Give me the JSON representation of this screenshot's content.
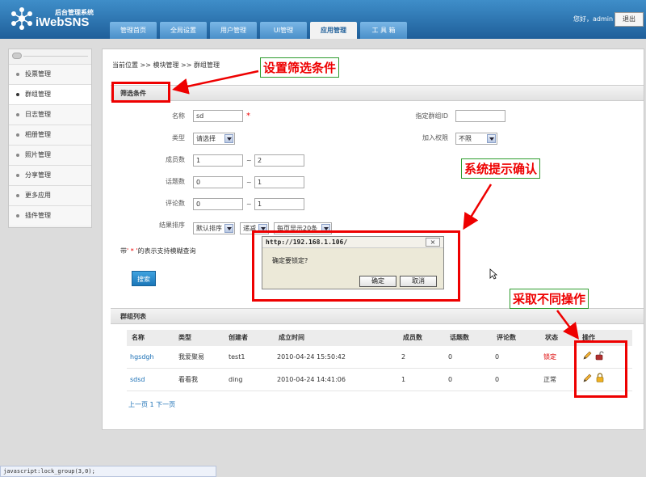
{
  "header": {
    "subtitle": "后台管理系统",
    "brand": "iWebSNS",
    "greeting": "您好，admin",
    "logout_label": "退出",
    "tabs": [
      {
        "label": "管理首页"
      },
      {
        "label": "全局设置"
      },
      {
        "label": "用户管理"
      },
      {
        "label": "UI管理"
      },
      {
        "label": "应用管理",
        "active": true
      },
      {
        "label": "工 具 箱"
      }
    ]
  },
  "sidebar": {
    "items": [
      {
        "label": "投票管理"
      },
      {
        "label": "群组管理",
        "active": true
      },
      {
        "label": "日志管理"
      },
      {
        "label": "相册管理"
      },
      {
        "label": "照片管理"
      },
      {
        "label": "分享管理"
      },
      {
        "label": "更多应用"
      },
      {
        "label": "插件管理"
      }
    ]
  },
  "breadcrumb": "当前位置 >> 模块管理 >> 群组管理",
  "filter": {
    "heading": "筛选条件",
    "name_label": "名称",
    "name_value": "sd",
    "required_mark": "*",
    "group_id_label": "指定群组ID",
    "group_id_value": "",
    "type_label": "类型",
    "type_value": "请选择",
    "join_label": "加入权限",
    "join_value": "不限",
    "members_label": "成员数",
    "members_min": "1",
    "members_max": "2",
    "topics_label": "话题数",
    "topics_min": "0",
    "topics_max": "1",
    "comments_label": "评论数",
    "comments_min": "0",
    "comments_max": "1",
    "range_sep": "~",
    "sort_label": "结果排序",
    "sort_value": "默认排序",
    "order_value": "递减",
    "per_page_value": "每页显示20条",
    "hint_prefix": "带",
    "hint_star": "' * '",
    "hint_suffix": "的表示支持模糊查询",
    "search_label": "搜索"
  },
  "dialog": {
    "title": "http://192.168.1.106/",
    "close_label": "×",
    "message": "确定要锁定?",
    "ok_label": "确定",
    "cancel_label": "取消"
  },
  "group_list": {
    "heading": "群组列表",
    "columns": [
      "名称",
      "类型",
      "创建者",
      "成立时间",
      "成员数",
      "话题数",
      "评论数",
      "状态",
      "操作"
    ],
    "rows": [
      {
        "name": "hgsdgh",
        "type": "我爱聚易",
        "creator": "test1",
        "created": "2010-04-24 15:50:42",
        "members": "2",
        "topics": "0",
        "comments": "0",
        "status": "锁定"
      },
      {
        "name": "sdsd",
        "type": "看看我",
        "creator": "ding",
        "created": "2010-04-24 14:41:06",
        "members": "1",
        "topics": "0",
        "comments": "0",
        "status": "正常"
      }
    ],
    "pager": "上一页 1 下一页"
  },
  "annotations": {
    "filter_callout": "设置筛选条件",
    "dialog_callout": "系统提示确认",
    "ops_callout": "采取不同操作"
  },
  "status_bar": "javascript:lock_group(3,0);",
  "colors": {
    "header_blue": "#1f5f9a",
    "annotation_red": "#e00000",
    "annotation_border_green": "#2e9c2e",
    "link_blue": "#1a6fb5"
  }
}
